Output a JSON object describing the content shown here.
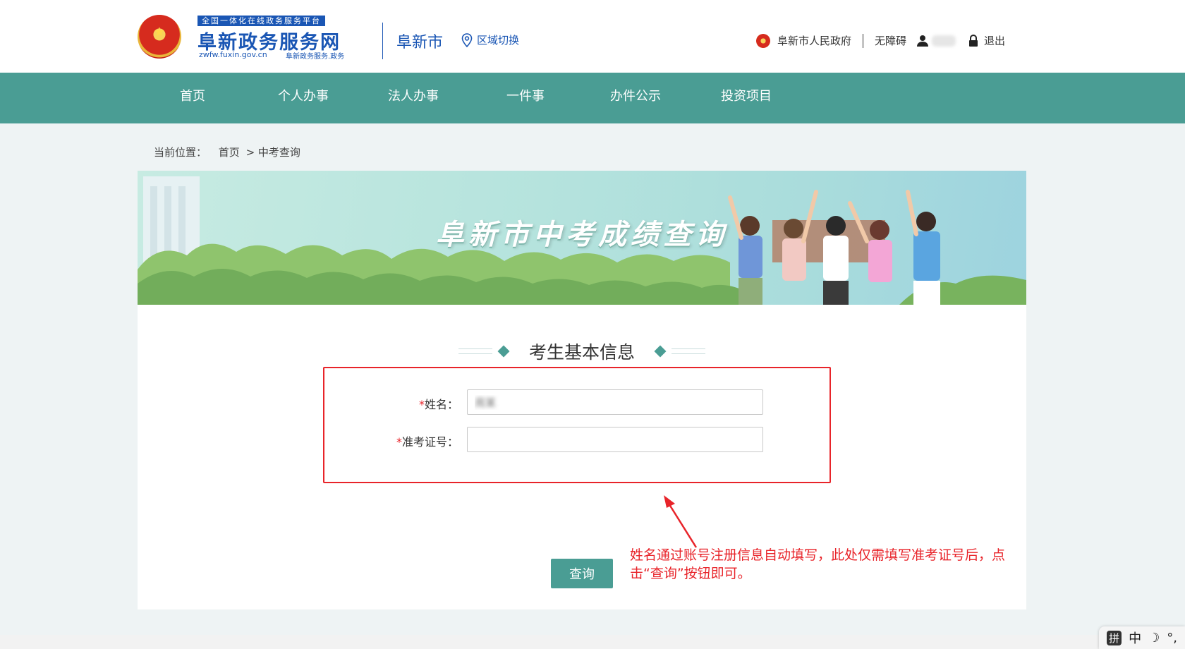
{
  "header": {
    "slogan": "全国一体化在线政务服务平台",
    "brand_name": "阜新政务服务网",
    "brand_url": "zwfw.fuxin.gov.cn",
    "brand_sub": "阜新政务服务.政务",
    "city": "阜新市",
    "region_switch": "区域切换",
    "gov_link": "阜新市人民政府",
    "accessibility": "无障碍",
    "logout": "退出"
  },
  "nav": {
    "items": [
      "首页",
      "个人办事",
      "法人办事",
      "一件事",
      "办件公示",
      "投资项目"
    ]
  },
  "breadcrumb": {
    "prefix": "当前位置：",
    "home": "首页",
    "current": "> 中考查询"
  },
  "banner": {
    "title": "阜新市中考成绩查询"
  },
  "form": {
    "section_title": "考生基本信息",
    "required_mark": "*",
    "name_label": "姓名：",
    "name_value": "周某",
    "ticket_label": "准考证号：",
    "ticket_value": "",
    "submit_label": "查询"
  },
  "annotation": {
    "text": "姓名通过账号注册信息自动填写，此处仅需填写准考证号后，点击“查询”按钮即可。",
    "color": "#e8242a"
  },
  "ime": {
    "items": [
      "拼",
      "中",
      "☽",
      "°,"
    ]
  },
  "colors": {
    "brand_blue": "#1a56b4",
    "nav_teal": "#4a9d94",
    "highlight_red": "#e8242a"
  }
}
